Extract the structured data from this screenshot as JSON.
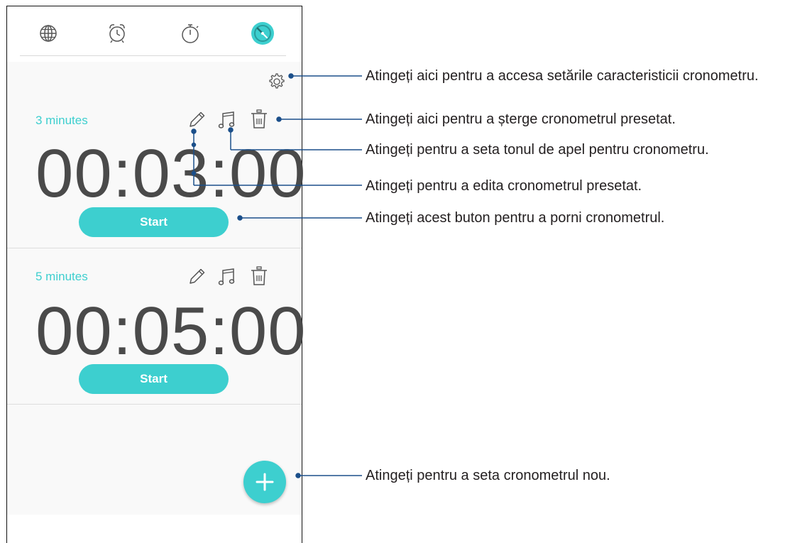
{
  "tabs": {
    "world_clock": "globe-icon",
    "alarm": "alarm-clock-icon",
    "stopwatch": "stopwatch-icon",
    "timer": "timer-icon",
    "active_color": "#3dcfcf"
  },
  "timers": [
    {
      "label": "3 minutes",
      "time": "00:03:00",
      "start_label": "Start"
    },
    {
      "label": "5 minutes",
      "time": "00:05:00",
      "start_label": "Start"
    }
  ],
  "accent_color": "#3dcfcf",
  "callouts": {
    "settings": "Atingeți aici pentru a accesa setările caracteristicii cronometru.",
    "delete": "Atingeți aici pentru a șterge cronometrul presetat.",
    "ringtone": "Atingeți pentru a seta tonul de apel pentru cronometru.",
    "edit": "Atingeți pentru a edita cronometrul presetat.",
    "start": "Atingeți acest buton pentru a porni cronometrul.",
    "add": "Atingeți pentru a seta cronometrul nou."
  }
}
